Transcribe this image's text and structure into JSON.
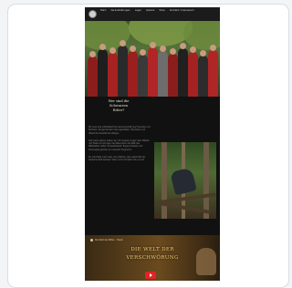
{
  "nav": {
    "logo_icon": "crest-logo-icon",
    "items": [
      {
        "label": "Start"
      },
      {
        "label": "Veranstaltungen"
      },
      {
        "label": "Lager"
      },
      {
        "label": "Galerie"
      },
      {
        "label": "Shop"
      },
      {
        "label": "Kontakt / Impressum"
      }
    ]
  },
  "hero": {
    "image": "group-photo-medieval-reenactors"
  },
  "intro": {
    "lines": [
      "Wer sind die",
      "Schwarzen",
      "Ritter?"
    ]
  },
  "body": {
    "paragraphs": [
      "Wir sind eine mittelalterliche Gemeinschaft aus Freunden und Familien, die gemeinsam das Lagerleben, Handwerk und ritterliche Kampfkunst pflegen.",
      "Seit vielen Jahren ziehen wir mit unserem Lager über Märkte und Feste und bringen den Besuchern die Welt des Mittelalters näher. Schwertkampf, Bogenschießen und Schauspiel gehören zu unserem Programm.",
      "Du möchtest mehr über uns erfahren oder selbst Teil der Gemeinschaft werden? Dann nimm Kontakt mit uns auf."
    ]
  },
  "knight_image": "knight-in-forest-photo",
  "banner": {
    "caption": "Die Welt der Ritter – Trailer",
    "title_line1": "DIE WELT DER",
    "title_line2": "VERSCHWÖRUNG",
    "play_icon": "play-icon",
    "accent": "#e02424"
  },
  "colors": {
    "page_bg": "#f3f4f6",
    "site_bg": "#111111",
    "title_gold": "#f2d27a"
  }
}
